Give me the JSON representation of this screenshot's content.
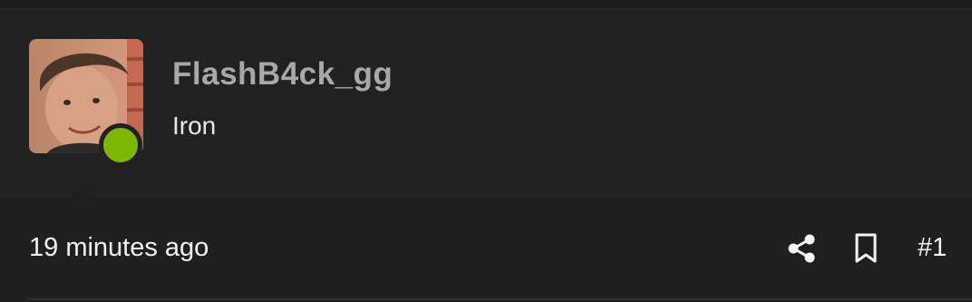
{
  "post": {
    "author": {
      "username": "FlashB4ck_gg",
      "title": "Iron",
      "online": true,
      "avatar_alt": "FlashB4ck_gg"
    },
    "footer": {
      "timestamp": "19 minutes ago",
      "post_number": "#1",
      "icons": [
        "share-icon",
        "bookmark-icon"
      ]
    }
  },
  "colors": {
    "background": "#202020",
    "username": "#a8a8a8",
    "text": "#f2f2f2",
    "online": "#7db800"
  }
}
